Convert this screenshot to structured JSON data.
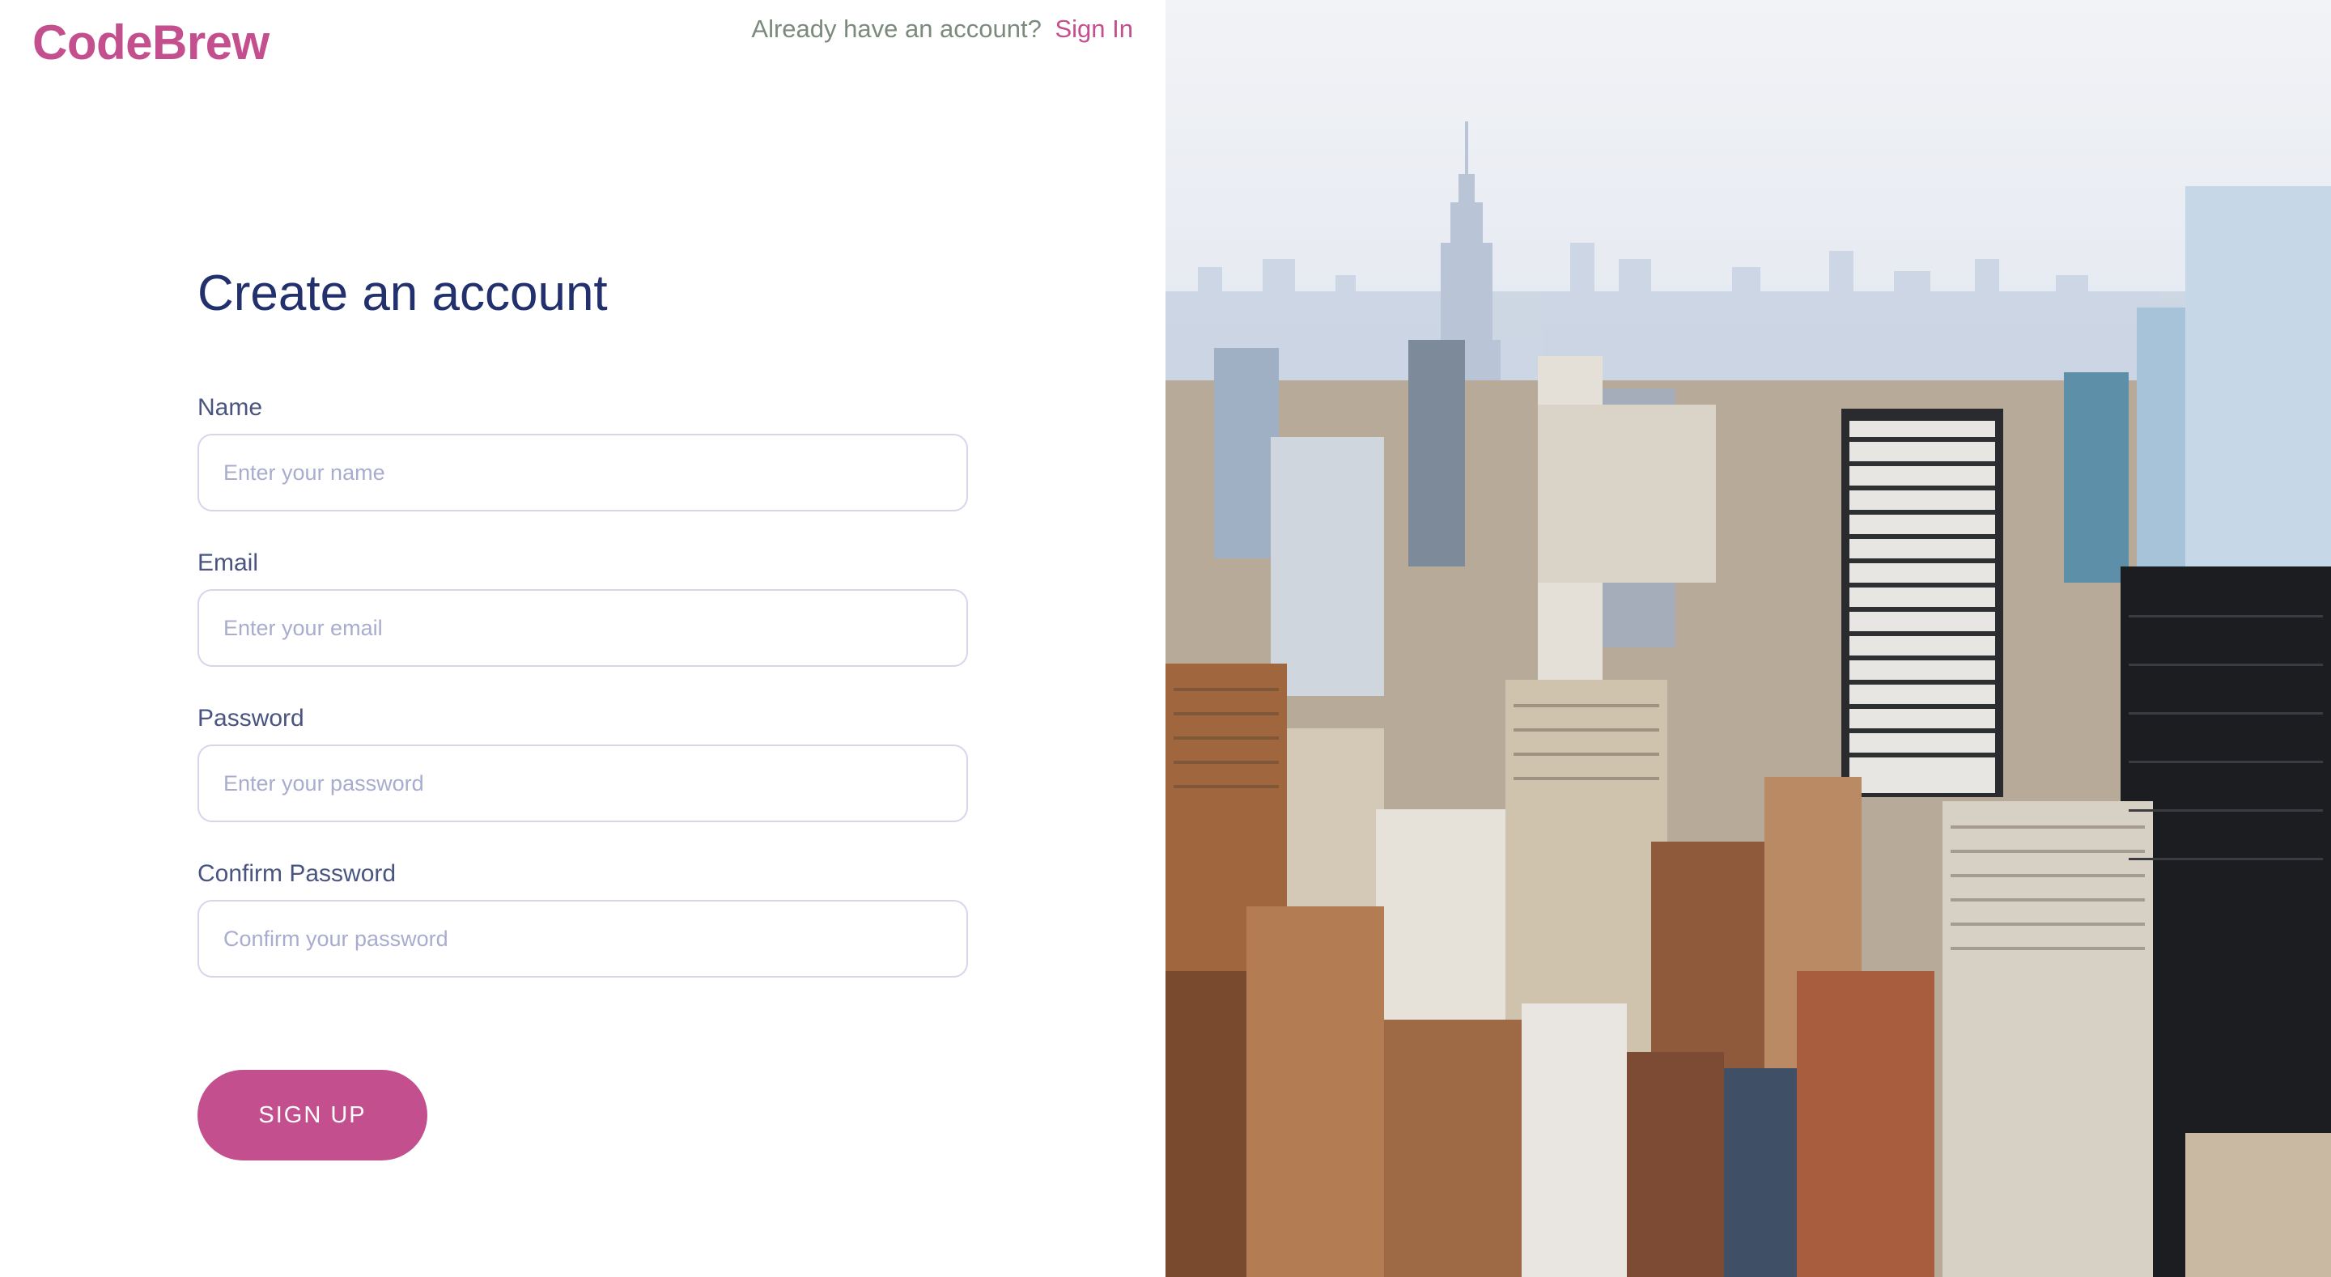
{
  "brand": {
    "name": "CodeBrew"
  },
  "topbar": {
    "prompt": "Already have an account?",
    "signin_label": "Sign In"
  },
  "form": {
    "title": "Create an account",
    "fields": [
      {
        "label": "Name",
        "placeholder": "Enter your name",
        "value": ""
      },
      {
        "label": "Email",
        "placeholder": "Enter your email",
        "value": ""
      },
      {
        "label": "Password",
        "placeholder": "Enter your password",
        "value": ""
      },
      {
        "label": "Confirm Password",
        "placeholder": "Confirm your password",
        "value": ""
      }
    ],
    "submit_label": "SIGN UP"
  },
  "colors": {
    "brand": "#c44f8e",
    "heading": "#23306e",
    "label": "#4a5480",
    "muted": "#7b8a7c",
    "input_border": "#d4d6ea"
  }
}
